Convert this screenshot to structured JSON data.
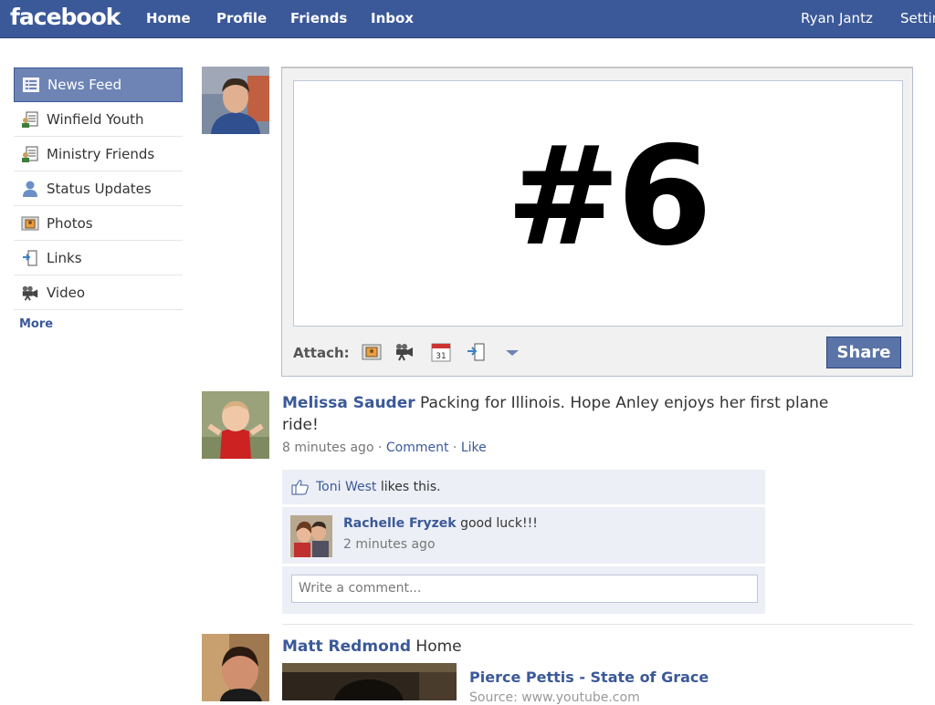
{
  "topbar": {
    "logo": "facebook",
    "nav": [
      "Home",
      "Profile",
      "Friends",
      "Inbox"
    ],
    "user_name": "Ryan Jantz",
    "settings": "Settin"
  },
  "sidebar": {
    "items": [
      {
        "label": "News Feed",
        "icon": "news-feed-icon"
      },
      {
        "label": "Winfield Youth",
        "icon": "group-list-icon"
      },
      {
        "label": "Ministry Friends",
        "icon": "group-list-icon"
      },
      {
        "label": "Status Updates",
        "icon": "person-icon"
      },
      {
        "label": "Photos",
        "icon": "photo-icon"
      },
      {
        "label": "Links",
        "icon": "link-icon"
      },
      {
        "label": "Video",
        "icon": "video-camera-icon"
      }
    ],
    "more": "More"
  },
  "composer": {
    "overlay_text": "#6",
    "attach_label": "Attach:",
    "share_label": "Share"
  },
  "story1": {
    "author": "Melissa Sauder",
    "text_line1": "Packing for Illinois. Hope Anley enjoys her first plane",
    "text_line2": "ride!",
    "time": "8 minutes ago",
    "sep": "·",
    "comment": "Comment",
    "like": "Like",
    "likes_name": "Toni West",
    "likes_suffix": "likes this.",
    "comment_author": "Rachelle Fryzek",
    "comment_text": "good luck!!!",
    "comment_time": "2 minutes ago",
    "write_placeholder": "Write a comment..."
  },
  "story2": {
    "author": "Matt Redmond",
    "text": "Home",
    "link_title": "Pierce Pettis - State of Grace",
    "link_source": "Source: www.youtube.com"
  },
  "colors": {
    "brand": "#3b5998",
    "share": "#5b74a8",
    "ufi_bg": "#eceff5"
  }
}
